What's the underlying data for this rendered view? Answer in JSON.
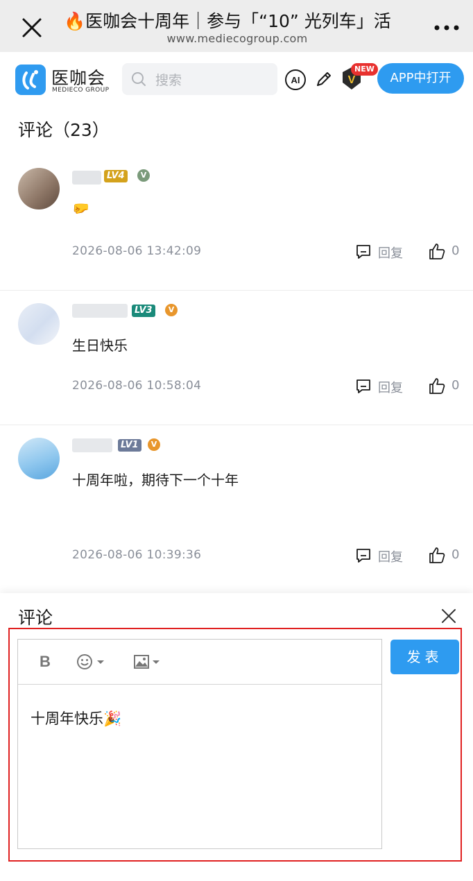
{
  "browser": {
    "title": "🔥医咖会十周年｜参与「“10” 光列车」活",
    "url": "www.mediecogroup.com"
  },
  "header": {
    "logo_name": "医咖会",
    "logo_sub": "MEDIECO GROUP",
    "search_placeholder": "搜索",
    "ai_label": "AI",
    "new_badge": "NEW",
    "vip_label": "V",
    "open_app_label": "APP中打开"
  },
  "comments_section": {
    "title": "评论（23）",
    "reply_label": "回复",
    "items": [
      {
        "level": "LV4",
        "level_color": "#d4a21c",
        "v_color": "#7a9a7a",
        "text": "🤛",
        "time": "2026-08-06 13:42:09",
        "likes": "0"
      },
      {
        "level": "LV3",
        "level_color": "#1a8a7a",
        "v_color": "#e8962c",
        "text": "生日快乐",
        "time": "2026-08-06 10:58:04",
        "likes": "0"
      },
      {
        "level": "LV1",
        "level_color": "#6c7a99",
        "v_color": "#e8962c",
        "text": "十周年啦，期待下一个十年",
        "time": "2026-08-06 10:39:36",
        "likes": "0"
      }
    ]
  },
  "compose": {
    "title": "评论",
    "bold_label": "B",
    "content": "十周年快乐🎉",
    "submit_label": "发表"
  },
  "colors": {
    "accent": "#2e9bf0",
    "highlight": "#e02020"
  }
}
